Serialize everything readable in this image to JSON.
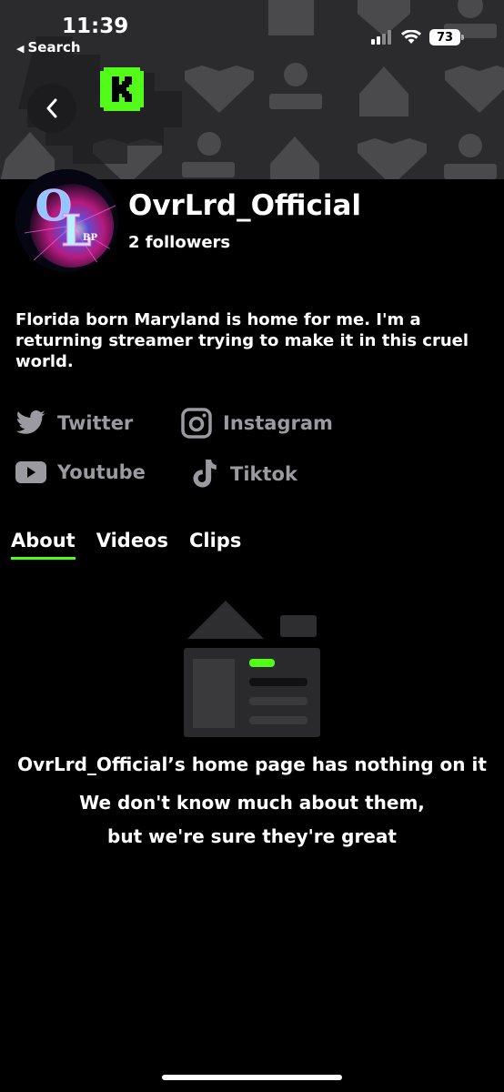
{
  "status_bar": {
    "time": "11:39",
    "back_app_label": "Search",
    "battery": "73"
  },
  "header": {
    "brand_letter": "K",
    "brand_color": "#53fc18"
  },
  "channel": {
    "name": "OvrLrd_Official",
    "followers": "2 followers",
    "bio": "Florida born Maryland is home for me. I'm a returning streamer trying to make it in this cruel world.",
    "avatar_text": [
      "OL",
      "BP"
    ]
  },
  "socials": [
    {
      "label": "Twitter",
      "icon": "twitter-icon"
    },
    {
      "label": "Instagram",
      "icon": "instagram-icon"
    },
    {
      "label": "Youtube",
      "icon": "youtube-icon"
    },
    {
      "label": "Tiktok",
      "icon": "tiktok-icon"
    }
  ],
  "tabs": [
    {
      "label": "About",
      "active": true
    },
    {
      "label": "Videos",
      "active": false
    },
    {
      "label": "Clips",
      "active": false
    }
  ],
  "empty_state": {
    "line1": "OvrLrd_Official’s home page has nothing on it",
    "line2": "We don't know much about them,",
    "line3": "but we're sure they're great"
  }
}
